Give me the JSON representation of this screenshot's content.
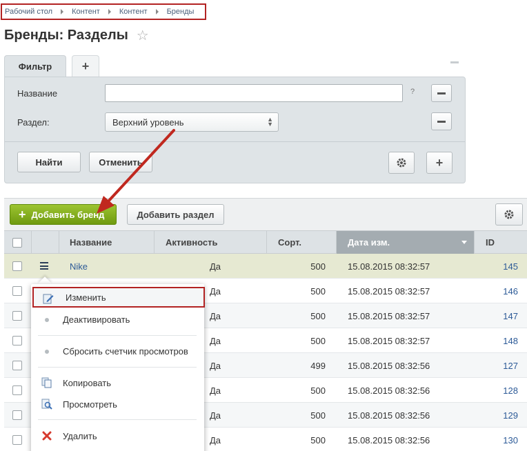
{
  "breadcrumb": [
    "Рабочий стол",
    "Контент",
    "Контент",
    "Бренды"
  ],
  "page": {
    "title": "Бренды: Разделы"
  },
  "filter": {
    "tab_label": "Фильтр",
    "add_tab": "+",
    "fields": [
      {
        "label": "Название",
        "value": ""
      },
      {
        "label": "Раздел:",
        "value": "Верхний уровень"
      }
    ],
    "help": "?",
    "find": "Найти",
    "cancel": "Отменить"
  },
  "toolbar": {
    "add_brand": "Добавить бренд",
    "add_section": "Добавить раздел"
  },
  "table": {
    "columns": [
      "Название",
      "Активность",
      "Сорт.",
      "Дата изм.",
      "ID"
    ],
    "sorted_column": "Дата изм.",
    "rows": [
      {
        "name": "Nike",
        "active": "Да",
        "sort": "500",
        "date": "15.08.2015 08:32:57",
        "id": "145"
      },
      {
        "name": "",
        "active": "Да",
        "sort": "500",
        "date": "15.08.2015 08:32:57",
        "id": "146"
      },
      {
        "name": "",
        "active": "Да",
        "sort": "500",
        "date": "15.08.2015 08:32:57",
        "id": "147"
      },
      {
        "name": "",
        "active": "Да",
        "sort": "500",
        "date": "15.08.2015 08:32:57",
        "id": "148"
      },
      {
        "name": "",
        "active": "Да",
        "sort": "499",
        "date": "15.08.2015 08:32:56",
        "id": "127"
      },
      {
        "name": "",
        "active": "Да",
        "sort": "500",
        "date": "15.08.2015 08:32:56",
        "id": "128"
      },
      {
        "name": "",
        "active": "Да",
        "sort": "500",
        "date": "15.08.2015 08:32:56",
        "id": "129"
      },
      {
        "name": "",
        "active": "Да",
        "sort": "500",
        "date": "15.08.2015 08:32:56",
        "id": "130"
      }
    ]
  },
  "context_menu": {
    "items": [
      {
        "label": "Изменить",
        "icon": "edit-icon"
      },
      {
        "label": "Деактивировать",
        "icon": "bullet-icon"
      },
      {
        "label": "Сбросить счетчик просмотров",
        "icon": "bullet-icon"
      },
      {
        "label": "Копировать",
        "icon": "copy-icon"
      },
      {
        "label": "Просмотреть",
        "icon": "view-icon"
      },
      {
        "label": "Удалить",
        "icon": "delete-icon"
      }
    ]
  },
  "colors": {
    "highlight_border": "#b22222",
    "primary_button": "#7aa51a",
    "link": "#2c5a97"
  }
}
